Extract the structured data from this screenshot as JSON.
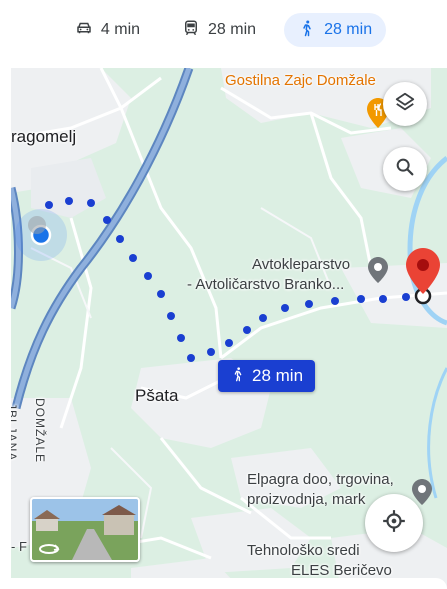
{
  "modes": [
    {
      "icon": "car-icon",
      "label": "4 min",
      "active": false
    },
    {
      "icon": "transit-icon",
      "label": "28 min",
      "active": false
    },
    {
      "icon": "walk-icon",
      "label": "28 min",
      "active": true
    }
  ],
  "map": {
    "places": {
      "dragomelj": "ragomelj",
      "gostilna": "Gostilna Zajc Domžale",
      "avtokleparstvo_1": "Avtokleparstvo",
      "avtokleparstvo_2": "- Avtoličarstvo Branko...",
      "psata": "Pšata",
      "elpagra_1": "Elpagra doo, trgovina,",
      "elpagra_2": "proizvodnja, mark",
      "tehnolosko_1": "Tehnološko sredi",
      "tehnolosko_2": "ELES Beričevo",
      "road_domzale": "DOMŽALE",
      "road_ljana": "JBLJANA",
      "dash": "- F"
    },
    "eta_label": "28 min"
  },
  "controls": {
    "layers_icon": "layers-icon",
    "search_icon": "search-icon",
    "location_icon": "my-location-icon"
  },
  "colors": {
    "route": "#1a3fd1",
    "active_mode": "#1a73e8",
    "destination_pin": "#ea4335",
    "map_green": "#dcefe3",
    "urban": "#eef0f2",
    "highway": "#5d86c0"
  }
}
